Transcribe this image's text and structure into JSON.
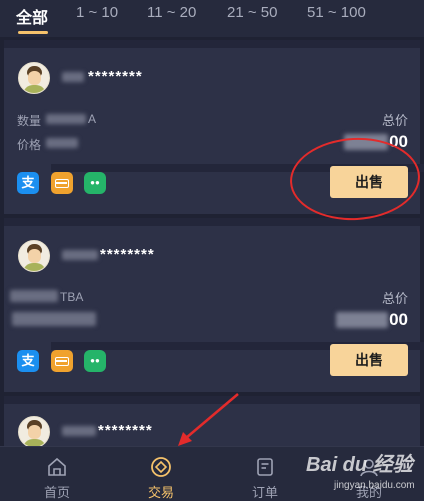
{
  "tabs": [
    {
      "label": "全部",
      "active": true
    },
    {
      "label": "1 ~ 10",
      "active": false
    },
    {
      "label": "11 ~ 20",
      "active": false
    },
    {
      "label": "21 ~ 50",
      "active": false
    },
    {
      "label": "51 ~ 100",
      "active": false
    }
  ],
  "listings": [
    {
      "name_masked": "********",
      "quantity_label": "数量",
      "quantity_suffix": "A",
      "price_label": "价格",
      "total_label": "总价",
      "total_value_suffix": "00",
      "sell_label": "出售"
    },
    {
      "name_masked": "********",
      "quantity_suffix": "TBA",
      "total_label": "总价",
      "total_value_suffix": "00",
      "sell_label": "出售"
    },
    {
      "name_masked": "********"
    }
  ],
  "payment_icons": [
    "alipay-icon",
    "bank-card-icon",
    "wechat-icon"
  ],
  "payment_glyphs": {
    "alipay": "支",
    "wechat": "●●"
  },
  "nav": [
    {
      "label": "首页",
      "icon": "home-icon",
      "active": false
    },
    {
      "label": "交易",
      "icon": "trade-icon",
      "active": true
    },
    {
      "label": "订单",
      "icon": "order-icon",
      "active": false
    },
    {
      "label": "我的",
      "icon": "profile-icon",
      "active": false
    }
  ],
  "watermark": {
    "logo": "Bai du 经验",
    "url": "jingyan.baidu.com"
  },
  "colors": {
    "accent": "#f5c26b",
    "sell_button": "#f8d49a",
    "annotation": "#e32b2b",
    "background": "#1f2233",
    "card": "#2d3147"
  }
}
